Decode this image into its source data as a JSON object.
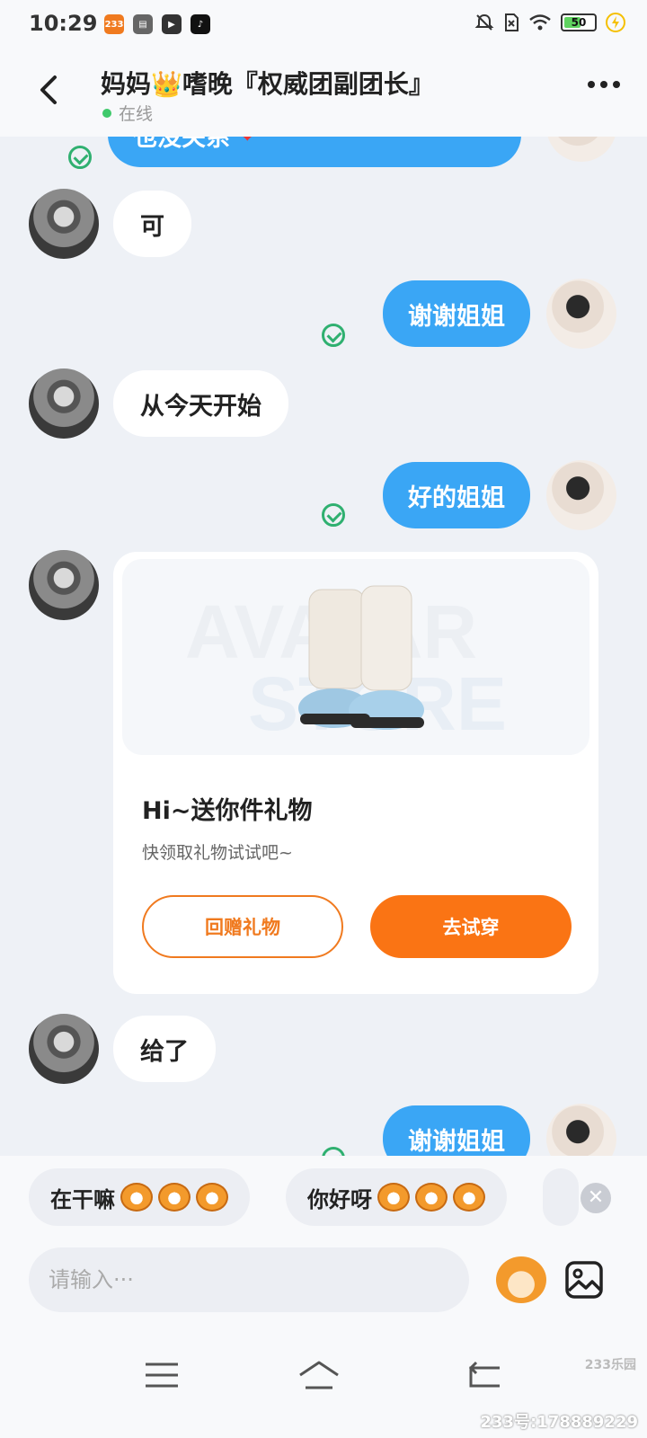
{
  "status_bar": {
    "time": "10:29",
    "app_badge": "233",
    "battery_level": "50",
    "colors": {
      "battery_fill": "#5fd35f",
      "badge": "#f07a1f"
    }
  },
  "header": {
    "title": "妈妈👑嗜晚『权威团副团长』",
    "status": "在线",
    "colors": {
      "online_dot": "#3fc96b"
    }
  },
  "messages": [
    {
      "dir": "out",
      "text": "也没关系"
    },
    {
      "dir": "in",
      "text": "可"
    },
    {
      "dir": "out",
      "text": "谢谢姐姐"
    },
    {
      "dir": "in",
      "text": "从今天开始"
    },
    {
      "dir": "out",
      "text": "好的姐姐"
    },
    {
      "dir": "in",
      "type": "gift"
    },
    {
      "dir": "in",
      "text": "给了"
    },
    {
      "dir": "out",
      "text": "谢谢姐姐"
    }
  ],
  "gift_card": {
    "image_watermark_line1": "AVATAR",
    "image_watermark_line2": "STORE",
    "title": "Hi~送你件礼物",
    "subtitle": "快领取礼物试试吧~",
    "return_gift_label": "回赠礼物",
    "try_on_label": "去试穿",
    "colors": {
      "accent": "#fa7414"
    }
  },
  "quick_replies": [
    {
      "text": "在干嘛"
    },
    {
      "text": "你好呀"
    }
  ],
  "input": {
    "placeholder": "请输入···"
  },
  "watermark": {
    "logo": "233乐园",
    "account": "233号:178889229"
  },
  "colors": {
    "outgoing_bubble": "#3aa6f5",
    "incoming_bubble": "#ffffff",
    "background": "#eef1f6",
    "sent_check": "#2fb070"
  }
}
